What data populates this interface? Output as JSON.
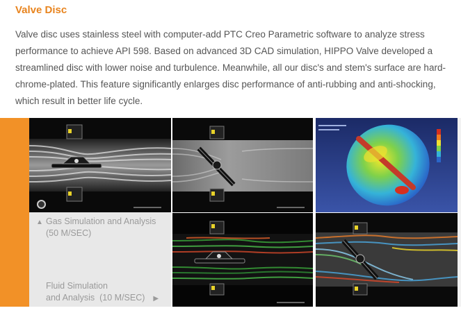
{
  "section": {
    "title": "Valve Disc",
    "description": "Valve disc uses stainless steel with computer-add PTC Creo Parametric software to analyze stress performance to achieve API 598. Based on advanced 3D CAD simulation, HIPPO Valve developed a streamlined disc with lower noise and turbulence. Meanwhile, all our disc's and stem's surface are hard-chrome-plated. This feature significantly enlarges disc performance of anti-rubbing and anti-shocking, which result in better life cycle."
  },
  "gallery": {
    "gas_link": {
      "arrow": "▲",
      "line1": "Gas Simulation and Analysis",
      "line2": "(50 M/SEC)"
    },
    "fluid_link": {
      "line1": "Fluid Simulation",
      "line2": "and Analysis  (10 M/SEC)",
      "arrow": "▶"
    },
    "images": [
      {
        "name": "gas-flow-disc-open",
        "icon": "flow-simulation-image"
      },
      {
        "name": "gas-flow-disc-angled",
        "icon": "flow-simulation-image"
      },
      {
        "name": "stress-analysis-disc",
        "icon": "fea-stress-image"
      },
      {
        "name": "fluid-flow-disc-open",
        "icon": "flow-simulation-image"
      },
      {
        "name": "fluid-flow-disc-angled",
        "icon": "flow-simulation-image"
      }
    ],
    "colors": {
      "accent": "#e8841e",
      "sidebar": "#f29127",
      "panel": "#e8e8e8",
      "text": "#555555",
      "link_text": "#9a9a9a"
    }
  }
}
